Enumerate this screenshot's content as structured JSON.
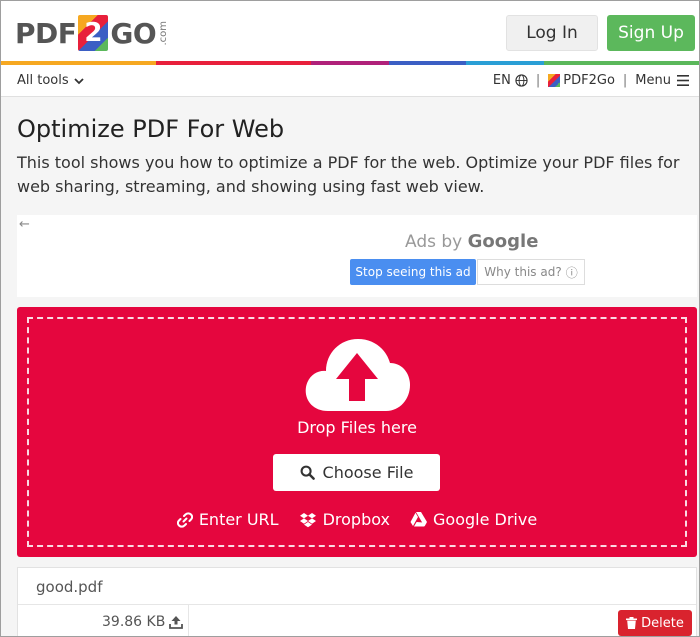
{
  "header": {
    "logo": {
      "left": "PDF",
      "middle": "2",
      "right": "GO",
      "suffix": ".com"
    },
    "login_label": "Log In",
    "signup_label": "Sign Up",
    "rainbow_colors": [
      "#f6a821",
      "#f6a821",
      "#e8203b",
      "#e8203b",
      "#b0217a",
      "#3b5fc4",
      "#2a9fd6",
      "#5bb85b",
      "#5bb85b"
    ]
  },
  "nav": {
    "all_tools": "All tools",
    "language": "EN",
    "separator": "|",
    "brand": "PDF2Go",
    "menu": "Menu"
  },
  "page": {
    "title": "Optimize PDF For Web",
    "description": "This tool shows you how to optimize a PDF for the web. Optimize your PDF files for web sharing, streaming, and showing using fast web view."
  },
  "ad": {
    "back": "←",
    "ads_by": "Ads by",
    "google": "Google",
    "stop_label": "Stop seeing this ad",
    "why_label": "Why this ad?",
    "why_icon": "ⓘ"
  },
  "upload": {
    "drop_text": "Drop Files here",
    "choose_label": "Choose File",
    "sources": [
      {
        "label": "Enter URL",
        "icon": "link-icon"
      },
      {
        "label": "Dropbox",
        "icon": "dropbox-icon"
      },
      {
        "label": "Google Drive",
        "icon": "google-drive-icon"
      }
    ],
    "accent_color": "#e5063e"
  },
  "file": {
    "name": "good.pdf",
    "size": "39.86 KB",
    "delete_label": "Delete"
  }
}
